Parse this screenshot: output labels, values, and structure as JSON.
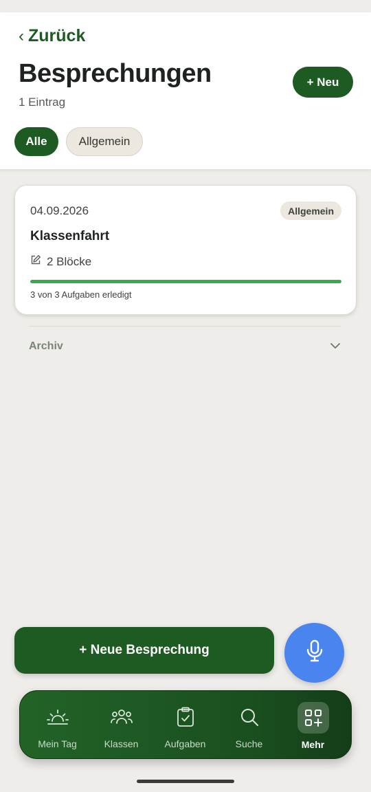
{
  "header": {
    "back_label": "Zurück",
    "title": "Besprechungen",
    "count_text": "1 Eintrag",
    "new_button": "+ Neu"
  },
  "filters": [
    {
      "label": "Alle",
      "active": true
    },
    {
      "label": "Allgemein",
      "active": false
    }
  ],
  "meetings": [
    {
      "date": "04.09.2026",
      "tag": "Allgemein",
      "title": "Klassenfahrt",
      "blocks": "2 Blöcke",
      "progress_fraction": 1.0,
      "progress_text": "3 von 3 Aufgaben erledigt"
    }
  ],
  "archive": {
    "label": "Archiv"
  },
  "actions": {
    "new_meeting": "+ Neue Besprechung",
    "mic_icon": "microphone-icon"
  },
  "tabbar": {
    "tabs": [
      {
        "label": "Mein Tag",
        "icon": "sunrise-icon",
        "active": false
      },
      {
        "label": "Klassen",
        "icon": "people-icon",
        "active": false
      },
      {
        "label": "Aufgaben",
        "icon": "clipboard-check-icon",
        "active": false
      },
      {
        "label": "Suche",
        "icon": "search-icon",
        "active": false
      },
      {
        "label": "Mehr",
        "icon": "grid-plus-icon",
        "active": true
      }
    ]
  },
  "colors": {
    "primary": "#1e5b23",
    "progress": "#3aa84d",
    "mic": "#4a84ee",
    "background": "#efede9"
  }
}
